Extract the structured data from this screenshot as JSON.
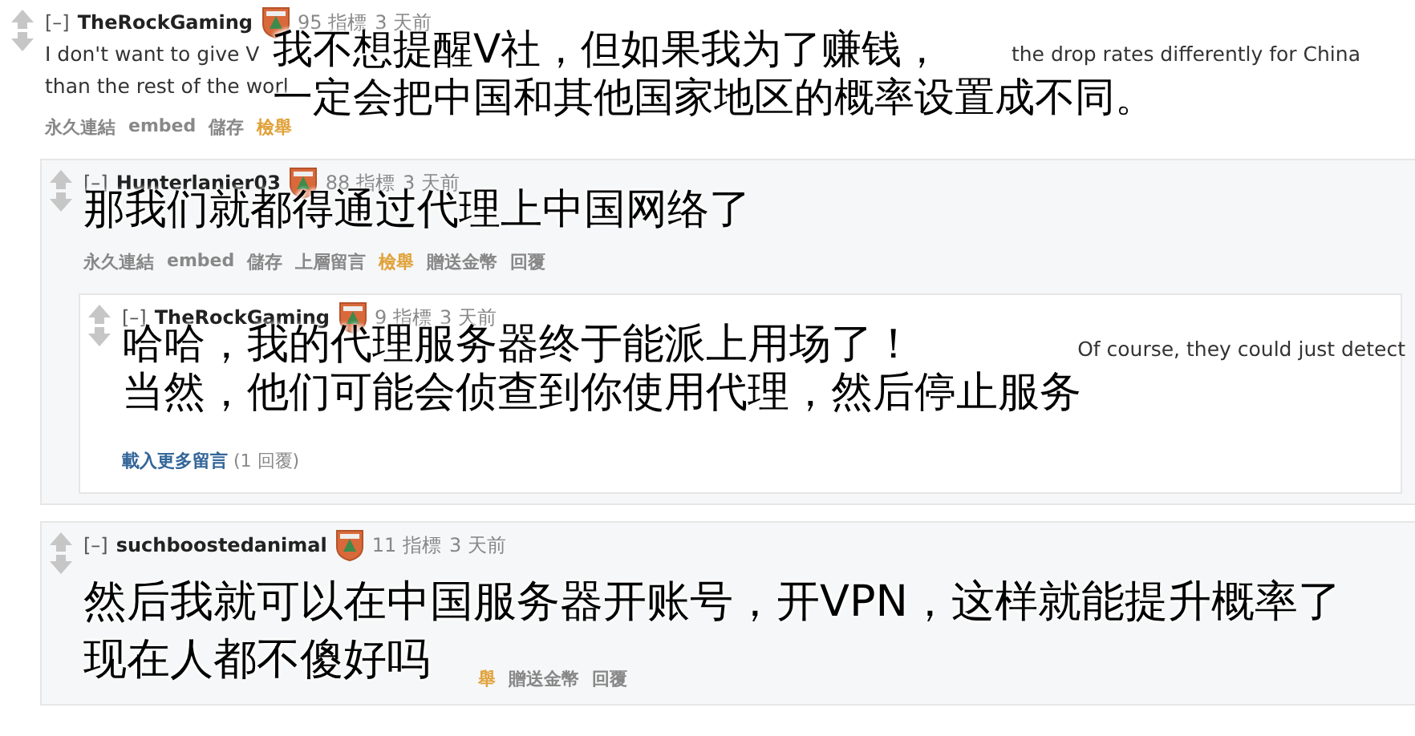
{
  "comments": [
    {
      "toggle": "[–]",
      "author": "TheRockGaming",
      "score": "95 指標",
      "time": "3 天前",
      "body": [
        {
          "left": "I don't want to give V",
          "right": "the drop rates differently for China"
        },
        {
          "left": "than the rest of the worl"
        }
      ],
      "caption": [
        "我不想提醒V社，但如果我为了赚钱，",
        "一定会把中国和其他国家地区的概率设置成不同。"
      ],
      "actions": [
        {
          "label": "永久連結",
          "kind": "link"
        },
        {
          "label": "embed",
          "kind": "link"
        },
        {
          "label": "儲存",
          "kind": "link"
        },
        {
          "label": "檢舉",
          "kind": "report"
        }
      ],
      "children": [
        {
          "toggle": "[–]",
          "author": "Hunterlanier03",
          "score": "88 指標",
          "time": "3 天前",
          "caption": [
            "那我们就都得通过代理上中国网络了"
          ],
          "actions": [
            {
              "label": "永久連結",
              "kind": "link"
            },
            {
              "label": "embed",
              "kind": "link"
            },
            {
              "label": "儲存",
              "kind": "link"
            },
            {
              "label": "上層留言",
              "kind": "link"
            },
            {
              "label": "檢舉",
              "kind": "report"
            },
            {
              "label": "贈送金幣",
              "kind": "link"
            },
            {
              "label": "回覆",
              "kind": "link"
            }
          ],
          "children": [
            {
              "toggle": "[–]",
              "author": "TheRockGaming",
              "score": "9 指標",
              "time": "3 天前",
              "body": [
                {
                  "right": "Of course, they could just detect"
                }
              ],
              "caption": [
                "哈哈，我的代理服务器终于能派上用场了！",
                "当然，他们可能会侦查到你使用代理，然后停止服务"
              ],
              "more": {
                "link": "載入更多留言",
                "count": "(1 回覆)"
              }
            }
          ]
        },
        {
          "toggle": "[–]",
          "author": "suchboostedanimal",
          "score": "11 指標",
          "time": "3 天前",
          "caption": [
            "然后我就可以在中国服务器开账号，开VPN，这样就能提升概率了",
            "现在人都不傻好吗"
          ],
          "actions": [
            {
              "label": "舉",
              "kind": "report"
            },
            {
              "label": "贈送金幣",
              "kind": "link"
            },
            {
              "label": "回覆",
              "kind": "link"
            }
          ]
        }
      ]
    }
  ]
}
